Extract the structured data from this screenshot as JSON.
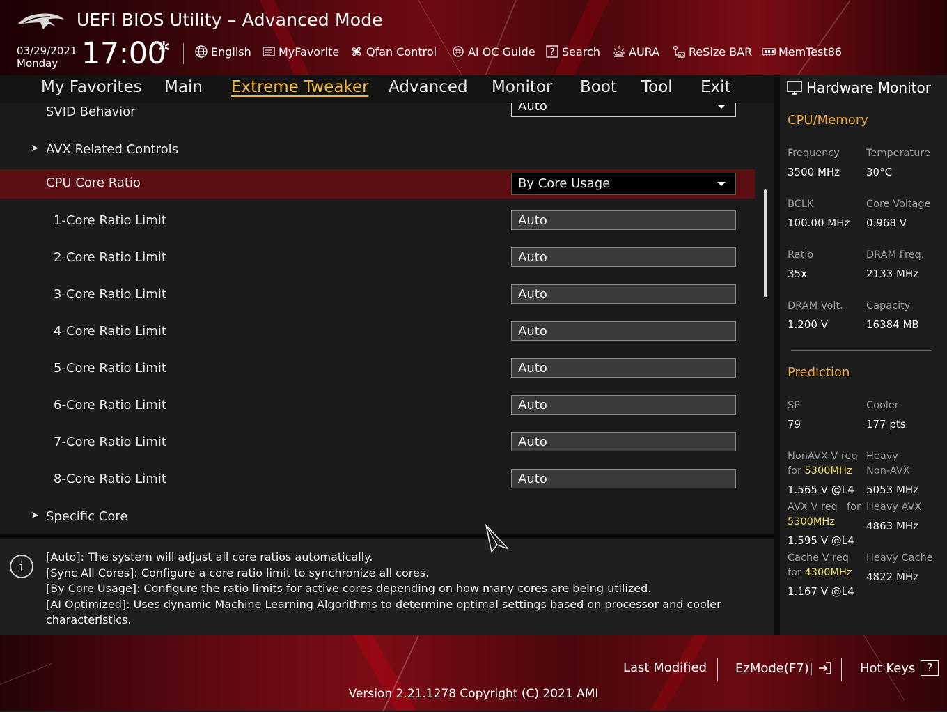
{
  "header": {
    "title": "UEFI BIOS Utility – Advanced Mode",
    "date": "03/29/2021",
    "day": "Monday",
    "time": "17:00",
    "tools": [
      {
        "label": "English",
        "icon": "globe-icon"
      },
      {
        "label": "MyFavorite",
        "icon": "favorite-list-icon"
      },
      {
        "label": "Qfan Control",
        "icon": "fan-icon"
      },
      {
        "label": "AI OC Guide",
        "icon": "ai-chip-icon"
      },
      {
        "label": "Search",
        "icon": "search-question-icon"
      },
      {
        "label": "AURA",
        "icon": "aura-light-icon"
      },
      {
        "label": "ReSize BAR",
        "icon": "resize-bar-icon"
      },
      {
        "label": "MemTest86",
        "icon": "memory-icon"
      }
    ]
  },
  "nav": {
    "tabs": [
      {
        "label": "My Favorites"
      },
      {
        "label": "Main"
      },
      {
        "label": "Extreme Tweaker",
        "active": true
      },
      {
        "label": "Advanced"
      },
      {
        "label": "Monitor"
      },
      {
        "label": "Boot"
      },
      {
        "label": "Tool"
      },
      {
        "label": "Exit"
      }
    ]
  },
  "settings": {
    "svid_behavior": {
      "label": "SVID Behavior",
      "value": "Auto"
    },
    "avx_related": {
      "label": "AVX Related Controls"
    },
    "cpu_core_ratio": {
      "label": "CPU Core Ratio",
      "value": "By Core Usage"
    },
    "core_limits": [
      {
        "label": "1-Core Ratio Limit",
        "value": "Auto"
      },
      {
        "label": "2-Core Ratio Limit",
        "value": "Auto"
      },
      {
        "label": "3-Core Ratio Limit",
        "value": "Auto"
      },
      {
        "label": "4-Core Ratio Limit",
        "value": "Auto"
      },
      {
        "label": "5-Core Ratio Limit",
        "value": "Auto"
      },
      {
        "label": "6-Core Ratio Limit",
        "value": "Auto"
      },
      {
        "label": "7-Core Ratio Limit",
        "value": "Auto"
      },
      {
        "label": "8-Core Ratio Limit",
        "value": "Auto"
      }
    ],
    "specific_core": {
      "label": "Specific Core"
    }
  },
  "help": {
    "lines": [
      "[Auto]: The system will adjust all core ratios automatically.",
      "[Sync All Cores]: Configure a core ratio limit to synchronize all cores.",
      "[By Core Usage]: Configure the ratio limits for active cores depending on how many cores are being utilized.",
      "[AI Optimized]: Uses dynamic Machine Learning Algorithms to determine optimal settings based on processor and cooler",
      "characteristics."
    ]
  },
  "hw_monitor": {
    "title": "Hardware Monitor",
    "cpu_memory": {
      "heading": "CPU/Memory",
      "frequency": {
        "label": "Frequency",
        "value": "3500 MHz"
      },
      "temperature": {
        "label": "Temperature",
        "value": "30°C"
      },
      "bclk": {
        "label": "BCLK",
        "value": "100.00 MHz"
      },
      "core_voltage": {
        "label": "Core Voltage",
        "value": "0.968 V"
      },
      "ratio": {
        "label": "Ratio",
        "value": "35x"
      },
      "dram_freq": {
        "label": "DRAM Freq.",
        "value": "2133 MHz"
      },
      "dram_volt": {
        "label": "DRAM Volt.",
        "value": "1.200 V"
      },
      "capacity": {
        "label": "Capacity",
        "value": "16384 MB"
      }
    },
    "prediction": {
      "heading": "Prediction",
      "sp": {
        "label": "SP",
        "value": "79"
      },
      "cooler": {
        "label": "Cooler",
        "value": "177 pts"
      },
      "nonavx": {
        "label1": "NonAVX V req",
        "label2_prefix": "for ",
        "freq": "5300MHz",
        "value": "1.565 V @L4"
      },
      "heavy_nonavx": {
        "label1": "Heavy",
        "label2": "Non-AVX",
        "value": "5053 MHz"
      },
      "avx": {
        "label1": "AVX V req",
        "label1_suffix": "for",
        "freq": "5300MHz",
        "value": "1.595 V @L4"
      },
      "heavy_avx": {
        "label": "Heavy AVX",
        "value": "4863 MHz"
      },
      "cache": {
        "label1": "Cache V req",
        "label2_prefix": "for ",
        "freq": "4300MHz",
        "value": "1.167 V @L4"
      },
      "heavy_cache": {
        "label": "Heavy Cache",
        "value": "4822 MHz"
      }
    }
  },
  "footer": {
    "last_modified": "Last Modified",
    "ezmode": "EzMode(F7)|",
    "hot_keys": "Hot Keys",
    "hot_keys_icon": "?",
    "version": "Version 2.21.1278 Copyright (C) 2021 AMI"
  },
  "colors": {
    "accent": "#f0b63a",
    "selected_row": "#5c0f12",
    "section_heading": "#e9a23a",
    "highlight_freq": "#f2e06a"
  }
}
